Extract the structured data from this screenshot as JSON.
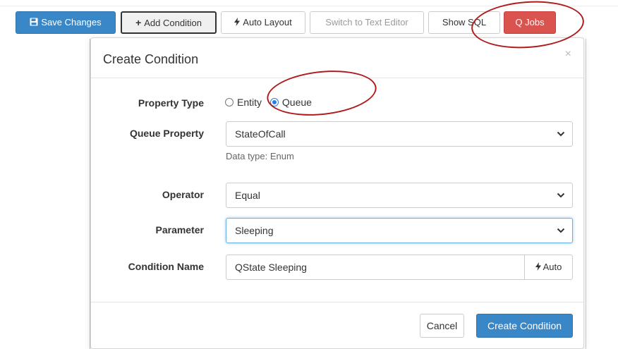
{
  "toolbar": {
    "save_label": "Save Changes",
    "add_condition_label": "Add Condition",
    "auto_layout_label": "Auto Layout",
    "text_editor_label": "Switch to Text Editor",
    "show_sql_label": "Show SQL",
    "q_jobs_label": "Q Jobs"
  },
  "modal": {
    "title": "Create Condition",
    "close_glyph": "×",
    "property_type": {
      "label": "Property Type",
      "options": [
        "Entity",
        "Queue"
      ],
      "selected": "Queue"
    },
    "queue_property": {
      "label": "Queue Property",
      "value": "StateOfCall",
      "help": "Data type: Enum"
    },
    "operator": {
      "label": "Operator",
      "value": "Equal"
    },
    "parameter": {
      "label": "Parameter",
      "value": "Sleeping"
    },
    "condition_name": {
      "label": "Condition Name",
      "value": "QState Sleeping",
      "auto_label": "Auto"
    },
    "cancel_label": "Cancel",
    "create_label": "Create Condition"
  },
  "icons": {
    "save": "floppy-disk-icon",
    "add": "plus-icon",
    "auto_layout": "bolt-icon",
    "auto_name": "bolt-icon",
    "caret": "chevron-down-icon",
    "close": "close-icon"
  },
  "colors": {
    "primary": "#3a87c8",
    "danger": "#d9534f",
    "annotation": "#b01c1c",
    "focus": "#66afe9"
  }
}
